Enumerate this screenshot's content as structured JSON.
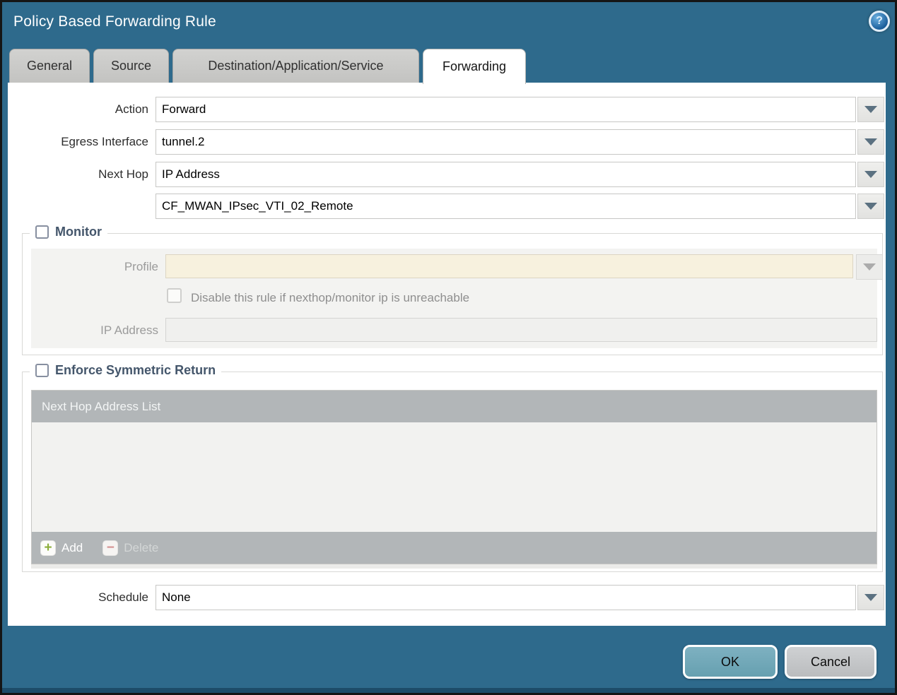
{
  "window": {
    "title": "Policy Based Forwarding Rule",
    "help_glyph": "?"
  },
  "tabs": [
    {
      "label": "General",
      "active": false
    },
    {
      "label": "Source",
      "active": false
    },
    {
      "label": "Destination/Application/Service",
      "active": false
    },
    {
      "label": "Forwarding",
      "active": true
    }
  ],
  "form": {
    "action": {
      "label": "Action",
      "value": "Forward"
    },
    "egress_interface": {
      "label": "Egress Interface",
      "value": "tunnel.2"
    },
    "next_hop": {
      "label": "Next Hop",
      "value": "IP Address"
    },
    "next_hop_address": {
      "value": "CF_MWAN_IPsec_VTI_02_Remote"
    },
    "monitor": {
      "label": "Monitor",
      "checked": false,
      "profile": {
        "label": "Profile",
        "value": ""
      },
      "disable_rule_label": "Disable this rule if nexthop/monitor ip is unreachable",
      "disable_rule_checked": false,
      "ip_address": {
        "label": "IP Address",
        "value": ""
      }
    },
    "symmetric_return": {
      "label": "Enforce Symmetric Return",
      "checked": false,
      "table_header": "Next Hop Address List",
      "rows": [],
      "add_label": "Add",
      "delete_label": "Delete",
      "add_glyph": "+",
      "delete_glyph": "−"
    },
    "schedule": {
      "label": "Schedule",
      "value": "None"
    }
  },
  "footer": {
    "ok_label": "OK",
    "cancel_label": "Cancel"
  },
  "colors": {
    "window_background": "#2e6a8c",
    "title_text": "#ffffff",
    "tab_inactive": "#c9c9c7",
    "tab_active": "#ffffff",
    "legend_text": "#44566b",
    "disabled_field_beige": "#f7f1de",
    "disabled_field_gray": "#f0f0ee",
    "table_header_gray": "#b2b6b8",
    "ok_button": "#6fa6b8",
    "cancel_button": "#c3c5c7",
    "add_icon_green": "#8cae3a",
    "delete_icon_red": "#d49090"
  }
}
